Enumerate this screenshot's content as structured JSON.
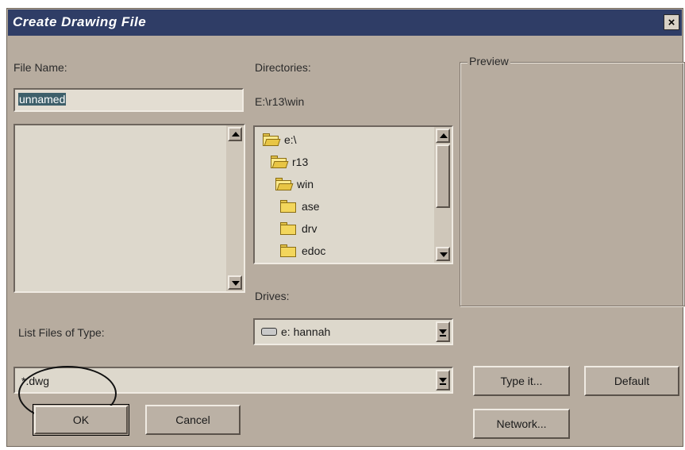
{
  "window": {
    "title": "Create Drawing File",
    "close_glyph": "×"
  },
  "file_name": {
    "label": "File Name:",
    "value": "unnamed"
  },
  "directories": {
    "label": "Directories:",
    "path": "E:\\r13\\win",
    "items": [
      {
        "label": "e:\\",
        "icon": "open-folder-icon"
      },
      {
        "label": "r13",
        "icon": "open-folder-icon"
      },
      {
        "label": "win",
        "icon": "open-folder-icon"
      },
      {
        "label": "ase",
        "icon": "folder-icon"
      },
      {
        "label": "drv",
        "icon": "folder-icon"
      },
      {
        "label": "edoc",
        "icon": "folder-icon"
      }
    ]
  },
  "preview": {
    "label": "Preview"
  },
  "drives": {
    "label": "Drives:",
    "value": "e: hannah"
  },
  "file_type": {
    "label": "List Files of Type:",
    "value": "*.dwg"
  },
  "buttons": {
    "ok": "OK",
    "cancel": "Cancel",
    "type_it": "Type it...",
    "default": "Default",
    "network": "Network..."
  },
  "colors": {
    "dialog_bg": "#b7ac9f",
    "title_bar": "#2f3d66",
    "list_bg": "#ddd8cc",
    "selection": "#3e5f6a",
    "folder": "#f3d65c"
  }
}
